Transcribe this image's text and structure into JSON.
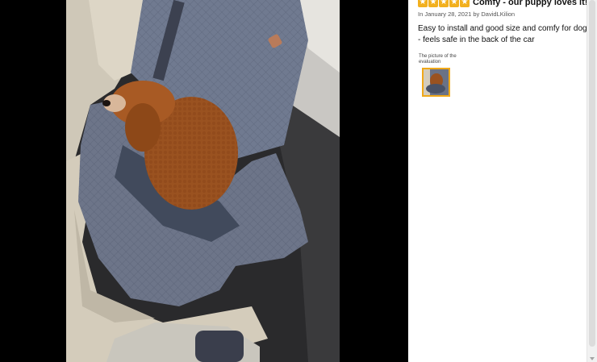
{
  "review": {
    "stars_count": 5,
    "star_color": "#f2b01e",
    "title": "Comfy - our puppy loves it!",
    "meta": "In January 28, 2021 by DavidLKilion",
    "body": "Easy to install and good size and comfy for dog - feels safe in the back of the car",
    "picture_caption": "The picture of the evaluation",
    "thumbnail_border_color": "#f0a818"
  }
}
